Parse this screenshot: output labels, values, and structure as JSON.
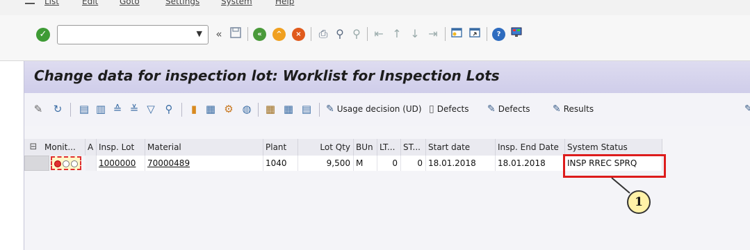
{
  "menu": [
    "List",
    "Edit",
    "Goto",
    "Settings",
    "System",
    "Help"
  ],
  "stdbar": {
    "command_value": "",
    "icons": [
      "enter-icon",
      "back-arrows-icon",
      "save-icon",
      "back-icon",
      "exit-icon",
      "cancel-icon",
      "print-icon",
      "find-icon",
      "find-next-icon",
      "first-page-icon",
      "prev-page-icon",
      "next-page-icon",
      "last-page-icon",
      "new-session-icon",
      "shortcut-icon",
      "help-icon",
      "customize-layout-icon"
    ]
  },
  "title": "Change data for inspection lot: Worklist for Inspection Lots",
  "appbar": {
    "usage_decision": "Usage decision (UD)",
    "defects1": "Defects",
    "defects2": "Defects",
    "results": "Results"
  },
  "grid": {
    "headers": {
      "monit": "Monit...",
      "a": "A",
      "insp_lot": "Insp. Lot",
      "material": "Material",
      "plant": "Plant",
      "lot_qty": "Lot Qty",
      "bun": "BUn",
      "lt": "LT...",
      "st": "ST...",
      "start_date": "Start date",
      "end_date": "Insp. End Date",
      "system_status": "System Status"
    },
    "rows": [
      {
        "insp_lot": "1000000",
        "material": "70000489",
        "plant": "1040",
        "lot_qty": "9,500",
        "bun": "M",
        "lt": "0",
        "st": "0",
        "start_date": "18.01.2018",
        "end_date": "18.01.2018",
        "system_status": "INSP RREC SPRQ"
      }
    ]
  },
  "callout": "1"
}
